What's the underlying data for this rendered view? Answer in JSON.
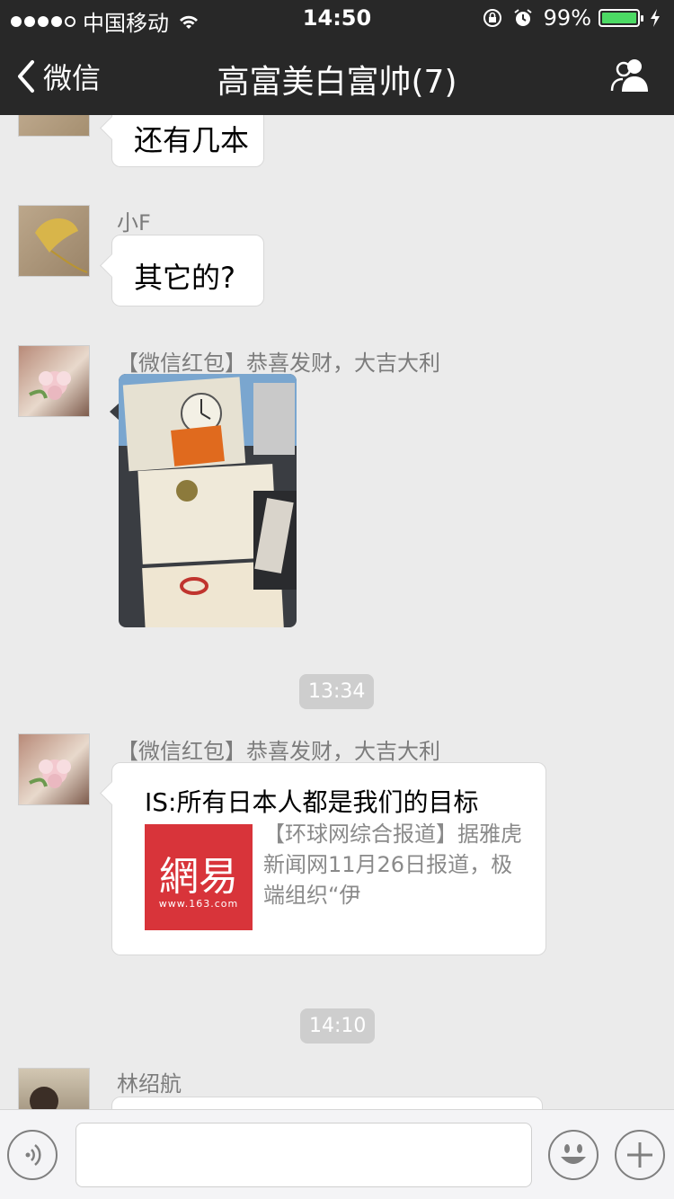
{
  "status_bar": {
    "carrier": "中国移动",
    "time": "14:50",
    "battery": "99%",
    "battery_level": 0.99
  },
  "nav": {
    "back_label": "微信",
    "title": "高富美白富帅(7)",
    "back_icon": "chevron-left-icon",
    "members_icon": "people-icon"
  },
  "messages": [
    {
      "sender": "",
      "text": "还有几本"
    },
    {
      "sender": "小F",
      "text": "其它的?"
    },
    {
      "sender": "【微信红包】恭喜发财，大吉大利",
      "type": "image"
    },
    {
      "timestamp": "13:34"
    },
    {
      "sender": "【微信红包】恭喜发财，大吉大利",
      "type": "link",
      "link_title": "IS:所有日本人都是我们的目标",
      "link_desc": "【环球网综合报道】据雅虎新闻网11月26日报道，极端组织“伊",
      "thumb_logo": "網易",
      "thumb_url_text": "www.163.com"
    },
    {
      "timestamp": "14:10"
    },
    {
      "sender": "林绍航",
      "text": ""
    }
  ],
  "input_bar": {
    "voice_icon": "voice-icon",
    "emoji_icon": "emoji-icon",
    "plus_icon": "plus-icon"
  }
}
